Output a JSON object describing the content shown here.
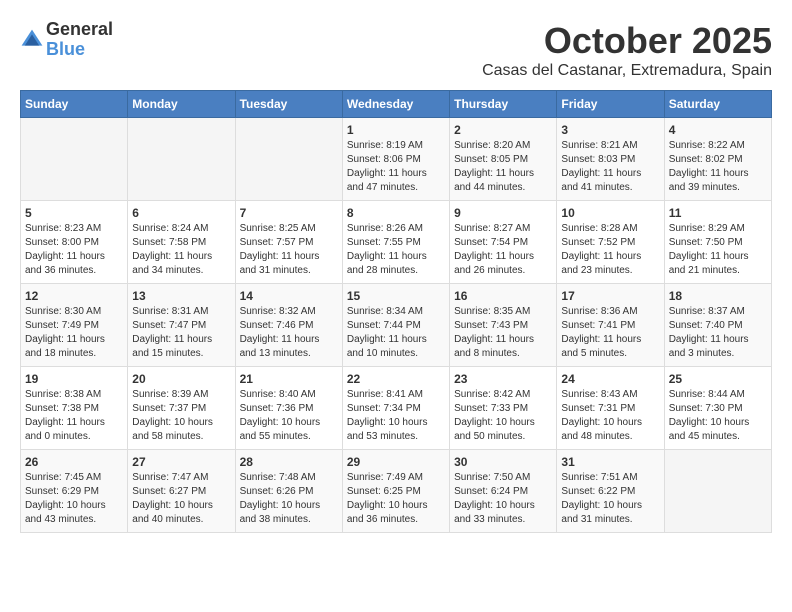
{
  "logo": {
    "general": "General",
    "blue": "Blue"
  },
  "title": "October 2025",
  "location": "Casas del Castanar, Extremadura, Spain",
  "days_of_week": [
    "Sunday",
    "Monday",
    "Tuesday",
    "Wednesday",
    "Thursday",
    "Friday",
    "Saturday"
  ],
  "weeks": [
    [
      {
        "day": "",
        "info": ""
      },
      {
        "day": "",
        "info": ""
      },
      {
        "day": "",
        "info": ""
      },
      {
        "day": "1",
        "info": "Sunrise: 8:19 AM\nSunset: 8:06 PM\nDaylight: 11 hours and 47 minutes."
      },
      {
        "day": "2",
        "info": "Sunrise: 8:20 AM\nSunset: 8:05 PM\nDaylight: 11 hours and 44 minutes."
      },
      {
        "day": "3",
        "info": "Sunrise: 8:21 AM\nSunset: 8:03 PM\nDaylight: 11 hours and 41 minutes."
      },
      {
        "day": "4",
        "info": "Sunrise: 8:22 AM\nSunset: 8:02 PM\nDaylight: 11 hours and 39 minutes."
      }
    ],
    [
      {
        "day": "5",
        "info": "Sunrise: 8:23 AM\nSunset: 8:00 PM\nDaylight: 11 hours and 36 minutes."
      },
      {
        "day": "6",
        "info": "Sunrise: 8:24 AM\nSunset: 7:58 PM\nDaylight: 11 hours and 34 minutes."
      },
      {
        "day": "7",
        "info": "Sunrise: 8:25 AM\nSunset: 7:57 PM\nDaylight: 11 hours and 31 minutes."
      },
      {
        "day": "8",
        "info": "Sunrise: 8:26 AM\nSunset: 7:55 PM\nDaylight: 11 hours and 28 minutes."
      },
      {
        "day": "9",
        "info": "Sunrise: 8:27 AM\nSunset: 7:54 PM\nDaylight: 11 hours and 26 minutes."
      },
      {
        "day": "10",
        "info": "Sunrise: 8:28 AM\nSunset: 7:52 PM\nDaylight: 11 hours and 23 minutes."
      },
      {
        "day": "11",
        "info": "Sunrise: 8:29 AM\nSunset: 7:50 PM\nDaylight: 11 hours and 21 minutes."
      }
    ],
    [
      {
        "day": "12",
        "info": "Sunrise: 8:30 AM\nSunset: 7:49 PM\nDaylight: 11 hours and 18 minutes."
      },
      {
        "day": "13",
        "info": "Sunrise: 8:31 AM\nSunset: 7:47 PM\nDaylight: 11 hours and 15 minutes."
      },
      {
        "day": "14",
        "info": "Sunrise: 8:32 AM\nSunset: 7:46 PM\nDaylight: 11 hours and 13 minutes."
      },
      {
        "day": "15",
        "info": "Sunrise: 8:34 AM\nSunset: 7:44 PM\nDaylight: 11 hours and 10 minutes."
      },
      {
        "day": "16",
        "info": "Sunrise: 8:35 AM\nSunset: 7:43 PM\nDaylight: 11 hours and 8 minutes."
      },
      {
        "day": "17",
        "info": "Sunrise: 8:36 AM\nSunset: 7:41 PM\nDaylight: 11 hours and 5 minutes."
      },
      {
        "day": "18",
        "info": "Sunrise: 8:37 AM\nSunset: 7:40 PM\nDaylight: 11 hours and 3 minutes."
      }
    ],
    [
      {
        "day": "19",
        "info": "Sunrise: 8:38 AM\nSunset: 7:38 PM\nDaylight: 11 hours and 0 minutes."
      },
      {
        "day": "20",
        "info": "Sunrise: 8:39 AM\nSunset: 7:37 PM\nDaylight: 10 hours and 58 minutes."
      },
      {
        "day": "21",
        "info": "Sunrise: 8:40 AM\nSunset: 7:36 PM\nDaylight: 10 hours and 55 minutes."
      },
      {
        "day": "22",
        "info": "Sunrise: 8:41 AM\nSunset: 7:34 PM\nDaylight: 10 hours and 53 minutes."
      },
      {
        "day": "23",
        "info": "Sunrise: 8:42 AM\nSunset: 7:33 PM\nDaylight: 10 hours and 50 minutes."
      },
      {
        "day": "24",
        "info": "Sunrise: 8:43 AM\nSunset: 7:31 PM\nDaylight: 10 hours and 48 minutes."
      },
      {
        "day": "25",
        "info": "Sunrise: 8:44 AM\nSunset: 7:30 PM\nDaylight: 10 hours and 45 minutes."
      }
    ],
    [
      {
        "day": "26",
        "info": "Sunrise: 7:45 AM\nSunset: 6:29 PM\nDaylight: 10 hours and 43 minutes."
      },
      {
        "day": "27",
        "info": "Sunrise: 7:47 AM\nSunset: 6:27 PM\nDaylight: 10 hours and 40 minutes."
      },
      {
        "day": "28",
        "info": "Sunrise: 7:48 AM\nSunset: 6:26 PM\nDaylight: 10 hours and 38 minutes."
      },
      {
        "day": "29",
        "info": "Sunrise: 7:49 AM\nSunset: 6:25 PM\nDaylight: 10 hours and 36 minutes."
      },
      {
        "day": "30",
        "info": "Sunrise: 7:50 AM\nSunset: 6:24 PM\nDaylight: 10 hours and 33 minutes."
      },
      {
        "day": "31",
        "info": "Sunrise: 7:51 AM\nSunset: 6:22 PM\nDaylight: 10 hours and 31 minutes."
      },
      {
        "day": "",
        "info": ""
      }
    ]
  ]
}
